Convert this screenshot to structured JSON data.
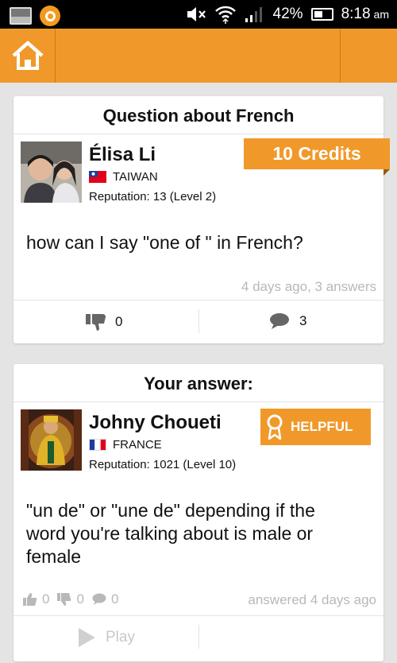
{
  "status_bar": {
    "battery": "42%",
    "time": "8:18",
    "ampm": "am"
  },
  "question_card": {
    "title": "Question about French",
    "user": {
      "name": "Élisa Li",
      "country": "TAIWAN",
      "reputation": "Reputation: 13 (Level 2)"
    },
    "credits": "10 Credits",
    "text": "how can I say \"one of \" in French?",
    "meta": "4 days ago, 3 answers",
    "dislikes": "0",
    "comments": "3"
  },
  "answer_card": {
    "title": "Your answer:",
    "user": {
      "name": "Johny Choueti",
      "country": "FRANCE",
      "reputation": "Reputation: 1021 (Level 10)"
    },
    "badge": "HELPFUL",
    "text": "\"un de\" or \"une de\" depending if the word you're talking about is male or female",
    "likes": "0",
    "dislikes": "0",
    "comments": "0",
    "meta": "answered 4 days ago",
    "play_label": "Play"
  },
  "colors": {
    "accent": "#f0992a",
    "background": "#e4e4e4",
    "muted_text": "#b8b8b8"
  }
}
